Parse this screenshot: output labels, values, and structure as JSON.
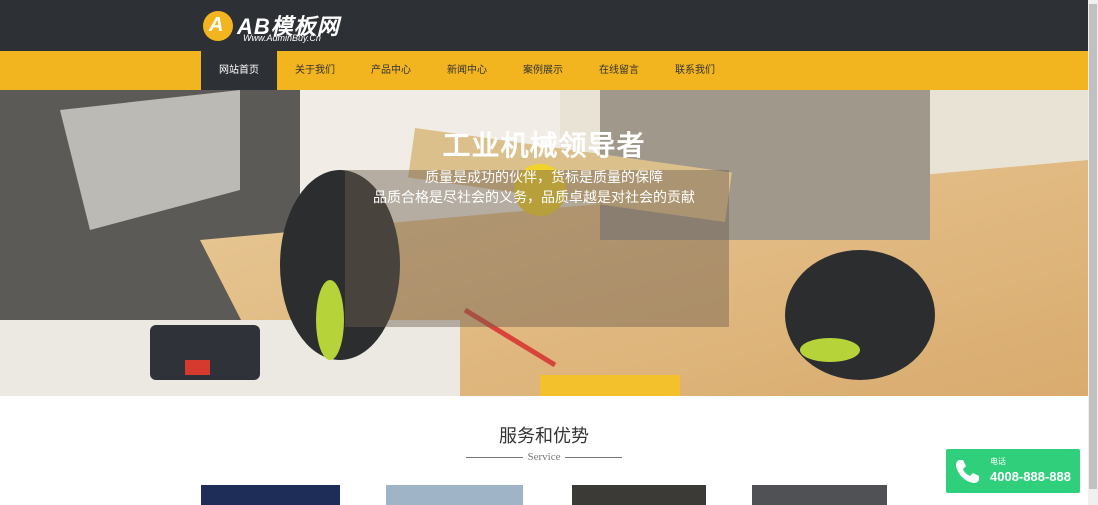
{
  "colors": {
    "brand": "#f3b51f",
    "dark": "#2d3034",
    "phone_green": "#2fcf7c"
  },
  "logo": {
    "text": "AB模板网",
    "badge": "A",
    "subtitle": "Www.AdminBuy.Cn"
  },
  "nav": {
    "items": [
      {
        "label": "网站首页",
        "active": true
      },
      {
        "label": "关于我们"
      },
      {
        "label": "产品中心"
      },
      {
        "label": "新闻中心"
      },
      {
        "label": "案例展示"
      },
      {
        "label": "在线留言"
      },
      {
        "label": "联系我们"
      }
    ]
  },
  "hero": {
    "title": "工业机械领导者",
    "line1": "质量是成功的伙伴，货标是质量的保障",
    "line2": "品质合格是尽社会的义务，品质卓越是对社会的贡献"
  },
  "service": {
    "title": "服务和优势",
    "subtitle": "Service"
  },
  "phone": {
    "label": "电话",
    "number": "4008-888-888",
    "icon": "phone-icon"
  }
}
